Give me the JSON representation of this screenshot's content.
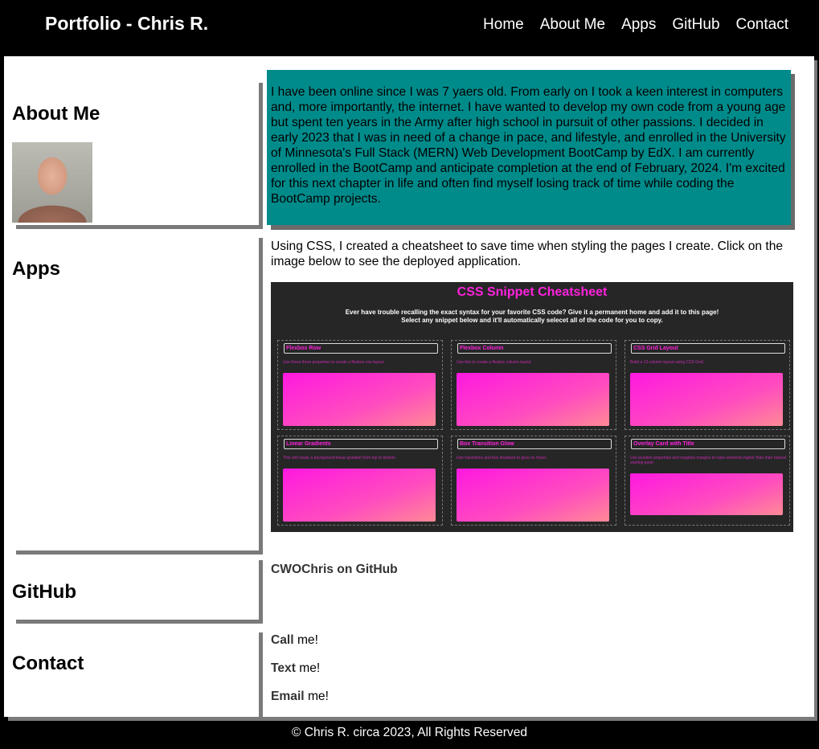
{
  "header": {
    "title": "Portfolio - Chris R.",
    "nav": [
      "Home",
      "About Me",
      "Apps",
      "GitHub",
      "Contact"
    ]
  },
  "about": {
    "heading": "About Me",
    "text": "I have been online since I was 7 yaers old. From early on I took a keen interest in computers and, more importantly, the internet. I have wanted to develop my own code from a young age but spent ten years in the Army after high school in pursuit of other passions. I decided in early 2023 that I was in need of a change in pace, and lifestyle, and enrolled in the University of Minnesota's Full Stack (MERN) Web Development BootCamp by EdX. I am currently enrolled in the BootCamp and anticipate completion at the end of February, 2024. I'm excited for this next chapter in life and often find myself losing track of time while coding the BootCamp projects."
  },
  "apps": {
    "heading": "Apps",
    "text": "Using CSS, I created a cheatsheet to save time when styling the pages I create. Click on the image below to see the deployed application.",
    "screenshot": {
      "title": "CSS Snippet Cheatsheet",
      "subtitle_1": "Ever have trouble recalling the exact syntax for your favorite CSS code? Give it a permanent home and add it to this page!",
      "subtitle_2": "Select any snippet below and it'll automatically selecet all of the code for you to copy.",
      "cards": [
        {
          "title": "Flexbox Row",
          "desc": "Use these three properties to create a flexbox row layout."
        },
        {
          "title": "Flexbox Column",
          "desc": "Use this to create a flexbox column layout."
        },
        {
          "title": "CSS Grid Layout",
          "desc": "Build a 12-column layout using CSS Grid."
        },
        {
          "title": "Linear Gradients",
          "desc": "This will create a background linear gradient from top to bottom."
        },
        {
          "title": "Box Transition Glow",
          "desc": "Use transitions and box shadows to glow on hover."
        },
        {
          "title": "Overlay Card with Title",
          "desc": "Use position properties and negative margins to raise elements higher than their natural starting point."
        }
      ]
    }
  },
  "github": {
    "heading": "GitHub",
    "link": "CWOChris on GitHub"
  },
  "contact": {
    "heading": "Contact",
    "items": [
      {
        "bold": "Call",
        "rest": " me!"
      },
      {
        "bold": "Text",
        "rest": " me!"
      },
      {
        "bold": "Email",
        "rest": " me!"
      }
    ]
  },
  "footer": {
    "text": "© Chris R. circa 2023, All Rights Reserved"
  }
}
